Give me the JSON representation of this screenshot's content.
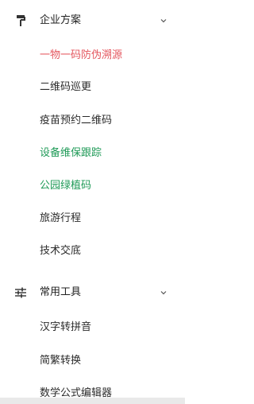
{
  "sections": [
    {
      "title": "企业方案",
      "icon": "paint-roller-icon",
      "items": [
        {
          "label": "一物一码防伪溯源",
          "state": "active"
        },
        {
          "label": "二维码巡更",
          "state": "normal"
        },
        {
          "label": "疫苗预约二维码",
          "state": "normal"
        },
        {
          "label": "设备维保跟踪",
          "state": "visited"
        },
        {
          "label": "公园绿植码",
          "state": "visited"
        },
        {
          "label": "旅游行程",
          "state": "normal"
        },
        {
          "label": "技术交底",
          "state": "normal"
        }
      ]
    },
    {
      "title": "常用工具",
      "icon": "sliders-icon",
      "items": [
        {
          "label": "汉字转拼音",
          "state": "normal"
        },
        {
          "label": "简繁转换",
          "state": "normal"
        },
        {
          "label": "数学公式编辑器",
          "state": "normal"
        }
      ]
    }
  ],
  "colors": {
    "active": "#e4565e",
    "visited": "#1f9a57",
    "text": "#2b2b2b"
  }
}
